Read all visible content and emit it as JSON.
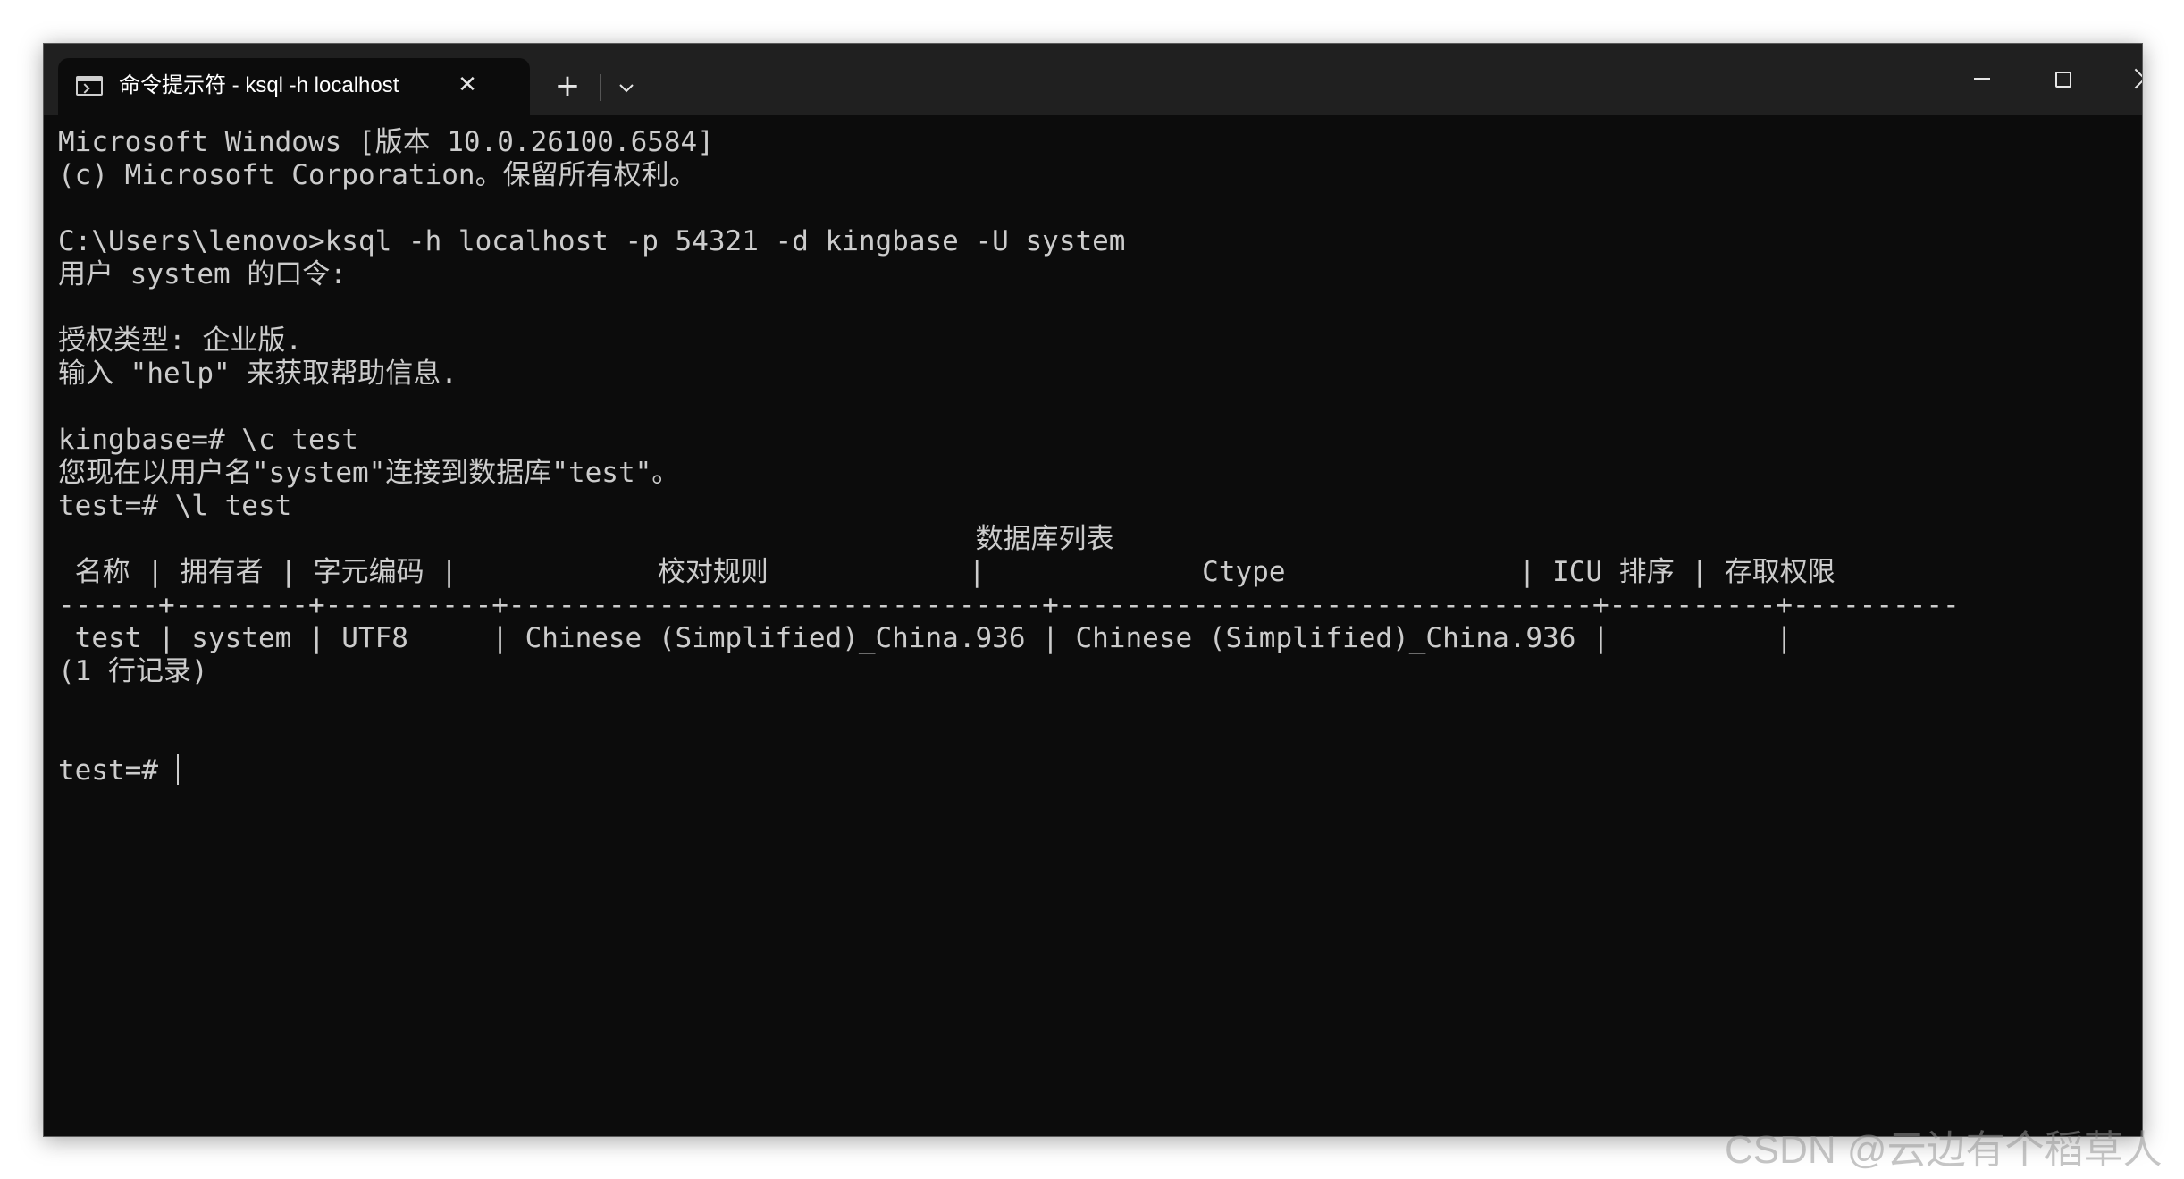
{
  "window": {
    "tab_title": "命令提示符 - ksql  -h localhost",
    "tab_icon": "terminal-icon",
    "new_tab_label": "+",
    "dropdown_icon": "chevron-down-icon",
    "close_tab_label": "✕",
    "controls": {
      "minimize": "minimize-icon",
      "maximize": "maximize-icon",
      "close": "close-icon"
    },
    "colors": {
      "titlebar": "#202020",
      "terminal_bg": "#0c0c0c",
      "terminal_fg": "#cccccc"
    }
  },
  "terminal": {
    "lines": [
      "Microsoft Windows [版本 10.0.26100.6584]",
      "(c) Microsoft Corporation。保留所有权利。",
      "",
      "C:\\Users\\lenovo>ksql -h localhost -p 54321 -d kingbase -U system",
      "用户 system 的口令:",
      "",
      "授权类型: 企业版.",
      "输入 \"help\" 来获取帮助信息.",
      "",
      "kingbase=# \\c test",
      "您现在以用户名\"system\"连接到数据库\"test\"。",
      "test=# \\l test",
      "                                                       数据库列表",
      " 名称 | 拥有者 | 字元编码 |            校对规则            |             Ctype              | ICU 排序 | 存取权限",
      "------+--------+----------+--------------------------------+--------------------------------+----------+----------",
      " test | system | UTF8     | Chinese (Simplified)_China.936 | Chinese (Simplified)_China.936 |          |",
      "(1 行记录)",
      "",
      ""
    ],
    "prompt": "test=# "
  },
  "watermark": "CSDN @云边有个稻草人"
}
